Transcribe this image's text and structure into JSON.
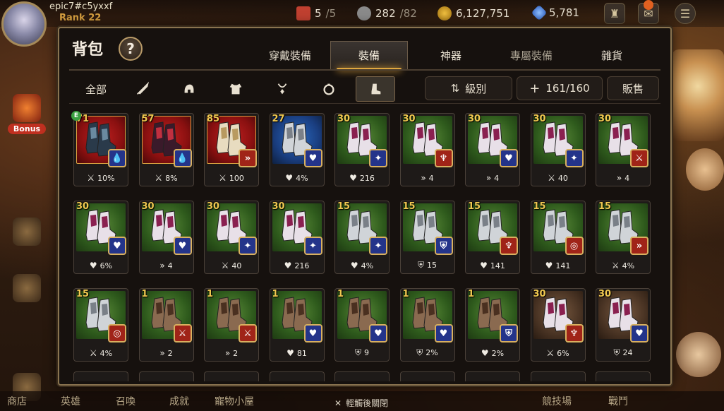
{
  "player": {
    "name": "epic7#c5yxxf",
    "rank": "Rank 22"
  },
  "resources": [
    {
      "name": "stamina",
      "value": "5",
      "max": "/5",
      "icon": "star-icon",
      "color": "#c04030"
    },
    {
      "name": "skystone-tickets",
      "value": "282",
      "max": "/82",
      "icon": "dollar-icon",
      "color": "#a8a8a8"
    },
    {
      "name": "gold",
      "value": "6,127,751",
      "max": "",
      "icon": "coin-icon",
      "color": "#d8a020"
    },
    {
      "name": "skystone",
      "value": "5,781",
      "max": "",
      "icon": "crystal-icon",
      "color": "#6090e0"
    }
  ],
  "side_menu": {
    "bonus": "Bonus",
    "items": [
      "",
      "",
      ""
    ]
  },
  "panel": {
    "title": "背包",
    "help": "?",
    "tabs": [
      "穿戴裝備",
      "裝備",
      "神器",
      "專屬裝備",
      "雜貨"
    ],
    "active_tab": 1,
    "filters": {
      "all": "全部",
      "icons": [
        "sword-icon",
        "helmet-icon",
        "armor-icon",
        "necklace-icon",
        "ring-icon",
        "boots-icon"
      ],
      "active": 6
    },
    "sort_label": "級別",
    "capacity": "161/160",
    "sell_label": "販售"
  },
  "items": [
    {
      "level": "71",
      "rarity": "red",
      "boot": "dark",
      "set": "navy",
      "set_icon": "💧",
      "stat_icon": "⚔",
      "stat": "10%",
      "equipped": "E"
    },
    {
      "level": "57",
      "rarity": "red",
      "boot": "darkred",
      "set": "navy",
      "set_icon": "💧",
      "stat_icon": "⚔",
      "stat": "8%"
    },
    {
      "level": "85",
      "rarity": "red",
      "boot": "gold",
      "set": "crimson",
      "set_icon": "»",
      "stat_icon": "⚔",
      "stat": "100"
    },
    {
      "level": "27",
      "rarity": "blue",
      "boot": "silver",
      "set": "navy",
      "set_icon": "♥",
      "stat_icon": "♥",
      "stat": "4%"
    },
    {
      "level": "30",
      "rarity": "green",
      "boot": "magenta",
      "set": "navy",
      "set_icon": "✦",
      "stat_icon": "♥",
      "stat": "216"
    },
    {
      "level": "30",
      "rarity": "green",
      "boot": "magenta",
      "set": "crimson",
      "set_icon": "♆",
      "stat_icon": "»",
      "stat": "4"
    },
    {
      "level": "30",
      "rarity": "green",
      "boot": "magenta",
      "set": "navy",
      "set_icon": "♥",
      "stat_icon": "»",
      "stat": "4"
    },
    {
      "level": "30",
      "rarity": "green",
      "boot": "magenta",
      "set": "navy",
      "set_icon": "✦",
      "stat_icon": "⚔",
      "stat": "40"
    },
    {
      "level": "30",
      "rarity": "green",
      "boot": "magenta",
      "set": "crimson",
      "set_icon": "⚔",
      "stat_icon": "»",
      "stat": "4"
    },
    {
      "level": "30",
      "rarity": "green",
      "boot": "magenta",
      "set": "navy",
      "set_icon": "♥",
      "stat_icon": "♥",
      "stat": "6%"
    },
    {
      "level": "30",
      "rarity": "green",
      "boot": "magenta",
      "set": "navy",
      "set_icon": "♥",
      "stat_icon": "»",
      "stat": "4"
    },
    {
      "level": "30",
      "rarity": "green",
      "boot": "magenta",
      "set": "navy",
      "set_icon": "✦",
      "stat_icon": "⚔",
      "stat": "40"
    },
    {
      "level": "30",
      "rarity": "green",
      "boot": "magenta",
      "set": "navy",
      "set_icon": "✦",
      "stat_icon": "♥",
      "stat": "216"
    },
    {
      "level": "15",
      "rarity": "green",
      "boot": "silver",
      "set": "navy",
      "set_icon": "✦",
      "stat_icon": "♥",
      "stat": "4%"
    },
    {
      "level": "15",
      "rarity": "green",
      "boot": "silver",
      "set": "navy",
      "set_icon": "⛨",
      "stat_icon": "⛨",
      "stat": "15"
    },
    {
      "level": "15",
      "rarity": "green",
      "boot": "silver",
      "set": "crimson",
      "set_icon": "♆",
      "stat_icon": "♥",
      "stat": "141"
    },
    {
      "level": "15",
      "rarity": "green",
      "boot": "silver",
      "set": "crimson",
      "set_icon": "◎",
      "stat_icon": "♥",
      "stat": "141"
    },
    {
      "level": "15",
      "rarity": "green",
      "boot": "silver",
      "set": "crimson",
      "set_icon": "»",
      "stat_icon": "⚔",
      "stat": "4%"
    },
    {
      "level": "15",
      "rarity": "green",
      "boot": "silver",
      "set": "crimson",
      "set_icon": "◎",
      "stat_icon": "⚔",
      "stat": "4%"
    },
    {
      "level": "1",
      "rarity": "green",
      "boot": "leather",
      "set": "crimson",
      "set_icon": "⚔",
      "stat_icon": "»",
      "stat": "2"
    },
    {
      "level": "1",
      "rarity": "green",
      "boot": "leather",
      "set": "crimson",
      "set_icon": "⚔",
      "stat_icon": "»",
      "stat": "2"
    },
    {
      "level": "1",
      "rarity": "green",
      "boot": "leather",
      "set": "navy",
      "set_icon": "♥",
      "stat_icon": "♥",
      "stat": "81"
    },
    {
      "level": "1",
      "rarity": "green",
      "boot": "leather",
      "set": "navy",
      "set_icon": "♥",
      "stat_icon": "⛨",
      "stat": "9"
    },
    {
      "level": "1",
      "rarity": "green",
      "boot": "leather",
      "set": "navy",
      "set_icon": "♥",
      "stat_icon": "⛨",
      "stat": "2%"
    },
    {
      "level": "1",
      "rarity": "green",
      "boot": "leather",
      "set": "navy",
      "set_icon": "⛨",
      "stat_icon": "♥",
      "stat": "2%"
    },
    {
      "level": "30",
      "rarity": "brown",
      "boot": "magenta",
      "set": "crimson",
      "set_icon": "♆",
      "stat_icon": "⚔",
      "stat": "6%"
    },
    {
      "level": "30",
      "rarity": "brown",
      "boot": "magenta",
      "set": "navy",
      "set_icon": "♥",
      "stat_icon": "⛨",
      "stat": "24"
    }
  ],
  "bottom_nav": [
    "商店",
    "英雄",
    "召喚",
    "成就",
    "寵物小屋",
    "競技場",
    "戰鬥"
  ],
  "close_hint": "輕觸後關閉",
  "colors": {
    "accent": "#e0a840",
    "frame": "#8a7450",
    "rarity_green": "#3a6a24",
    "rarity_red": "#a01818",
    "rarity_blue": "#1e4a90"
  }
}
